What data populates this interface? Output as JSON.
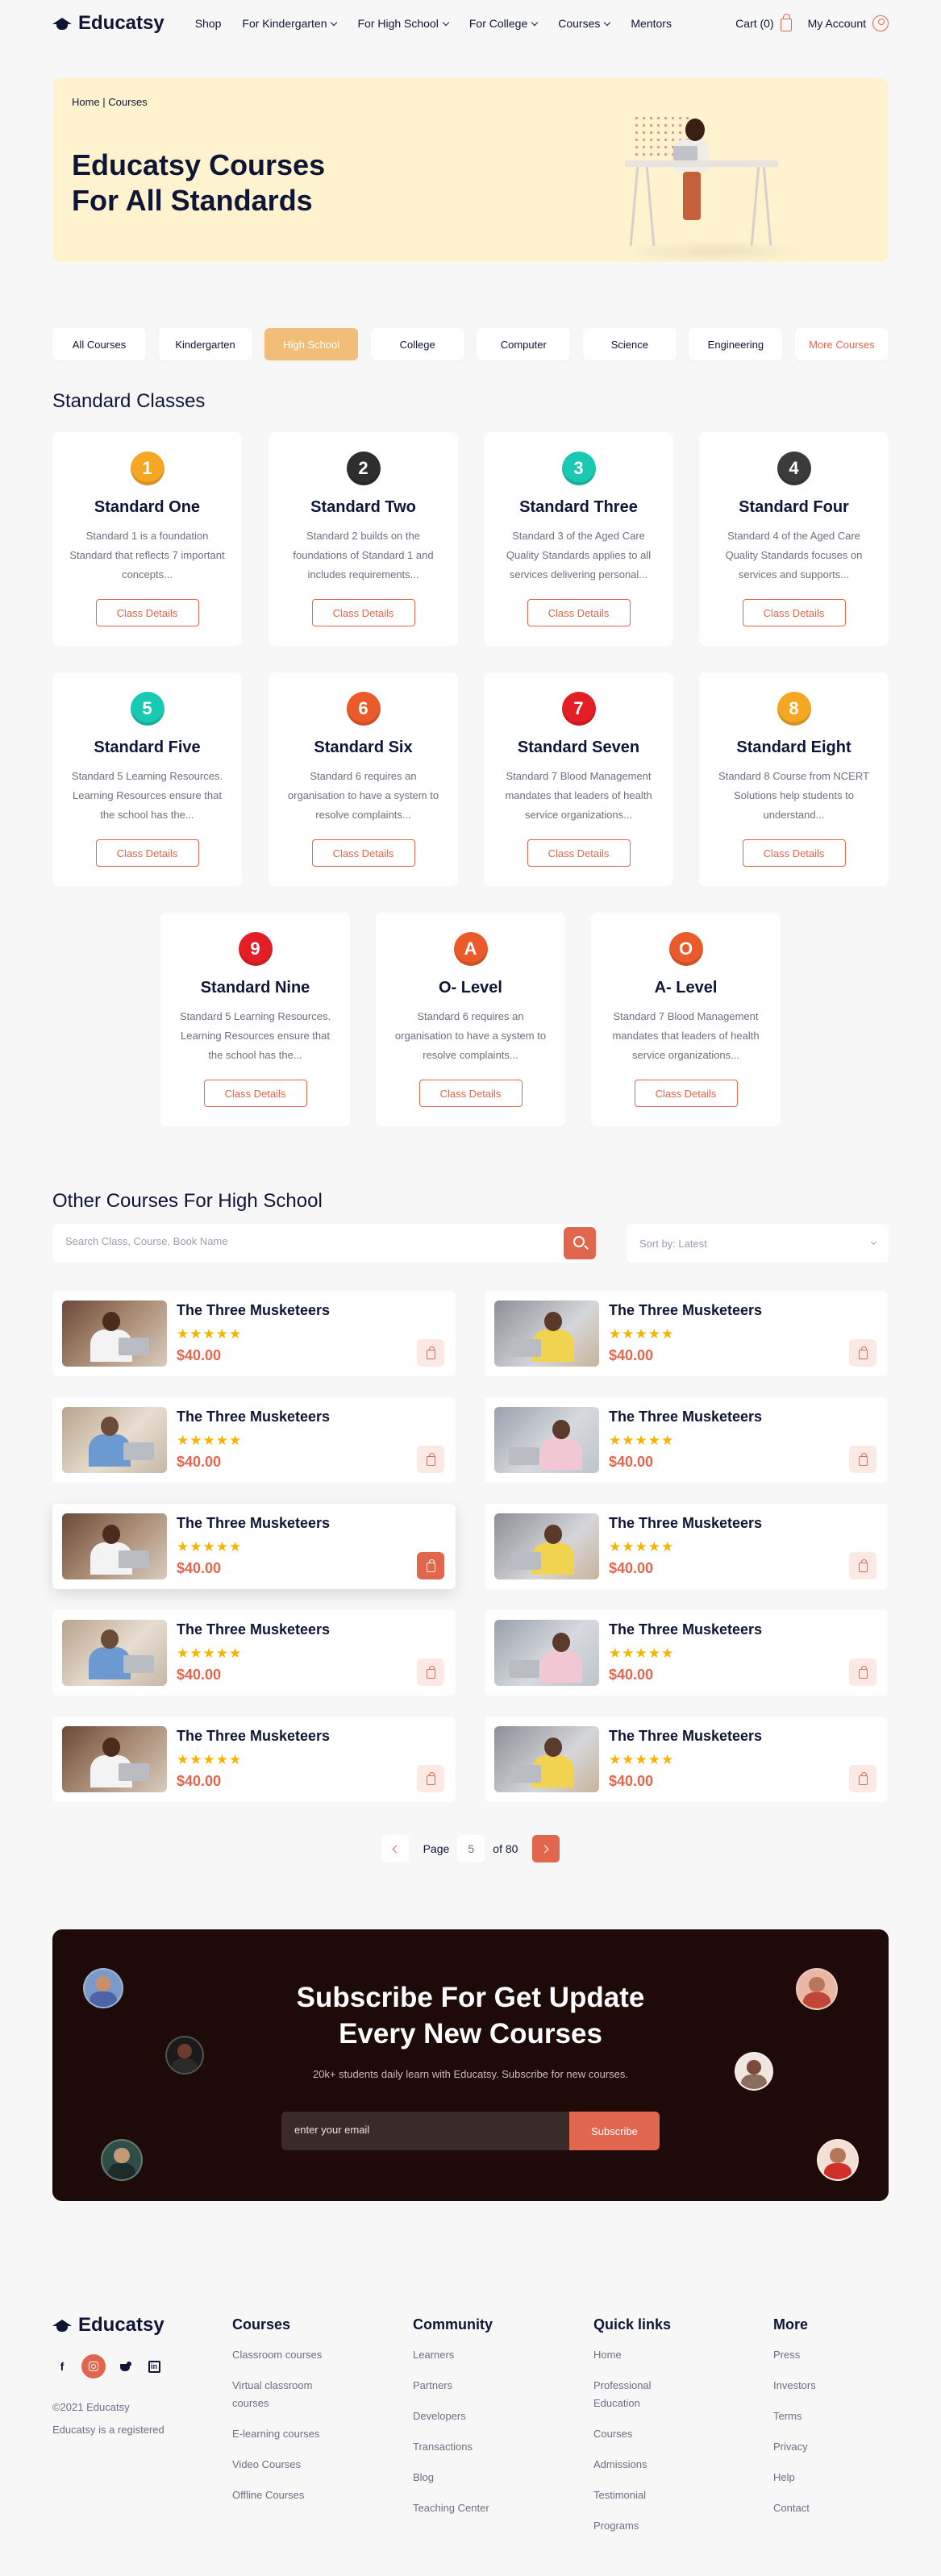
{
  "header": {
    "logo": "Educatsy",
    "nav": [
      {
        "label": "Shop",
        "dropdown": false
      },
      {
        "label": "For Kindergarten",
        "dropdown": true
      },
      {
        "label": "For High School",
        "dropdown": true
      },
      {
        "label": "For College",
        "dropdown": true
      },
      {
        "label": "Courses",
        "dropdown": true
      },
      {
        "label": "Mentors",
        "dropdown": false
      }
    ],
    "cart": "Cart (0)",
    "account": "My Account"
  },
  "hero": {
    "breadcrumb": "Home | Courses",
    "title_line1": "Educatsy Courses",
    "title_line2": "For All Standards"
  },
  "tabs": [
    {
      "label": "All Courses",
      "state": "default"
    },
    {
      "label": "Kindergarten",
      "state": "default"
    },
    {
      "label": "High School",
      "state": "active"
    },
    {
      "label": "College",
      "state": "default"
    },
    {
      "label": "Computer",
      "state": "default"
    },
    {
      "label": "Science",
      "state": "default"
    },
    {
      "label": "Engineering",
      "state": "default"
    },
    {
      "label": "More Courses",
      "state": "more"
    }
  ],
  "standard_classes": {
    "title": "Standard Classes",
    "button_label": "Class Details",
    "cards": [
      {
        "badge": "1",
        "color": "#f5a623",
        "title": "Standard One",
        "desc": "Standard 1 is a foundation Standard that reflects 7 important concepts..."
      },
      {
        "badge": "2",
        "color": "#2e2e2e",
        "title": "Standard Two",
        "desc": "Standard 2 builds on the foundations of Standard 1 and includes requirements..."
      },
      {
        "badge": "3",
        "color": "#19c9b1",
        "title": "Standard Three",
        "desc": "Standard 3 of the Aged Care Quality Standards applies to all services delivering personal..."
      },
      {
        "badge": "4",
        "color": "#3b3b3b",
        "title": "Standard Four",
        "desc": "Standard 4 of the Aged Care Quality Standards focuses on services and supports..."
      },
      {
        "badge": "5",
        "color": "#19c9b1",
        "title": "Standard Five",
        "desc": "Standard 5 Learning Resources. Learning Resources ensure that the school has the..."
      },
      {
        "badge": "6",
        "color": "#ea5a2a",
        "title": "Standard Six",
        "desc": "Standard 6 requires an organisation to have a system to resolve complaints..."
      },
      {
        "badge": "7",
        "color": "#e41e26",
        "title": "Standard Seven",
        "desc": "Standard 7 Blood Management mandates that leaders of health service organizations..."
      },
      {
        "badge": "8",
        "color": "#f5a623",
        "title": "Standard Eight",
        "desc": "Standard 8 Course from NCERT Solutions help students to understand..."
      },
      {
        "badge": "9",
        "color": "#e41e26",
        "title": "Standard Nine",
        "desc": "Standard 5 Learning Resources. Learning Resources ensure that the school has the..."
      },
      {
        "badge": "A",
        "color": "#ea5a2a",
        "title": "O- Level",
        "desc": "Standard 6 requires an organisation to have a system to resolve complaints..."
      },
      {
        "badge": "O",
        "color": "#ea5a2a",
        "title": "A- Level",
        "desc": "Standard 7 Blood Management mandates that leaders of health service organizations..."
      }
    ]
  },
  "other_courses": {
    "title": "Other Courses For High School",
    "search_placeholder": "Search Class, Course, Book Name",
    "sort_label": "Sort by: Latest",
    "items": [
      {
        "title": "The Three Musketeers",
        "stars": "★★★★★",
        "price": "$40.00",
        "active": false,
        "photo": "a"
      },
      {
        "title": "The Three Musketeers",
        "stars": "★★★★★",
        "price": "$40.00",
        "active": false,
        "photo": "b"
      },
      {
        "title": "The Three Musketeers",
        "stars": "★★★★★",
        "price": "$40.00",
        "active": false,
        "photo": "c"
      },
      {
        "title": "The Three Musketeers",
        "stars": "★★★★★",
        "price": "$40.00",
        "active": false,
        "photo": "d"
      },
      {
        "title": "The Three Musketeers",
        "stars": "★★★★★",
        "price": "$40.00",
        "active": true,
        "photo": "a"
      },
      {
        "title": "The Three Musketeers",
        "stars": "★★★★★",
        "price": "$40.00",
        "active": false,
        "photo": "b"
      },
      {
        "title": "The Three Musketeers",
        "stars": "★★★★★",
        "price": "$40.00",
        "active": false,
        "photo": "c"
      },
      {
        "title": "The Three Musketeers",
        "stars": "★★★★★",
        "price": "$40.00",
        "active": false,
        "photo": "d"
      },
      {
        "title": "The Three Musketeers",
        "stars": "★★★★★",
        "price": "$40.00",
        "active": false,
        "photo": "a"
      },
      {
        "title": "The Three Musketeers",
        "stars": "★★★★★",
        "price": "$40.00",
        "active": false,
        "photo": "b"
      }
    ]
  },
  "pagination": {
    "page_label": "Page",
    "current": "5",
    "of_label": "of 80"
  },
  "subscribe": {
    "title_line1": "Subscribe For Get Update",
    "title_line2": "Every New Courses",
    "subtitle": "20k+ students daily learn with Educatsy. Subscribe for new courses.",
    "placeholder": "enter your email",
    "button": "Subscribe"
  },
  "footer": {
    "logo": "Educatsy",
    "copyright_line1": "©2021 Educatsy",
    "copyright_line2": "Educatsy is a registered",
    "columns": [
      {
        "title": "Courses",
        "links": [
          "Classroom courses",
          "Virtual classroom courses",
          "E-learning courses",
          "Video Courses",
          "Offline Courses"
        ]
      },
      {
        "title": "Community",
        "links": [
          "Learners",
          "Partners",
          "Developers",
          "Transactions",
          "Blog",
          "Teaching Center"
        ]
      },
      {
        "title": "Quick links",
        "links": [
          "Home",
          "Professional Education",
          "Courses",
          "Admissions",
          "Testimonial",
          "Programs"
        ]
      },
      {
        "title": "More",
        "links": [
          "Press",
          "Investors",
          "Terms",
          "Privacy",
          "Help",
          "Contact"
        ]
      }
    ]
  },
  "colors": {
    "accent": "#e0674d",
    "hero_bg": "#fff2cf",
    "tab_active": "#f2bd76",
    "subscribe_bg": "#1e0a08",
    "text": "#0f1535"
  }
}
